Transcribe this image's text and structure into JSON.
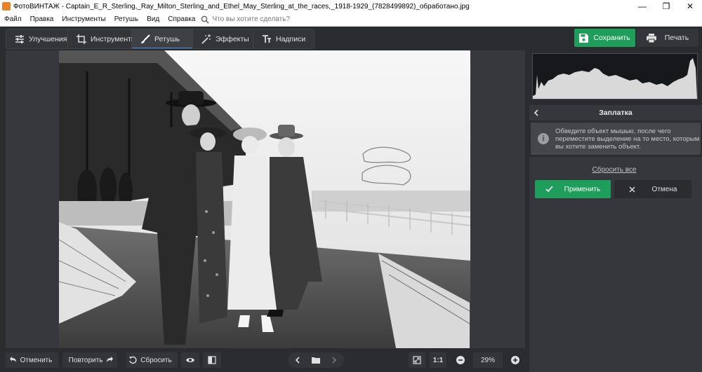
{
  "window": {
    "title": "ФотоВИНТАЖ - Captain_E_R_Sterling,_Ray_Milton_Sterling_and_Ethel_May_Sterling_at_the_races,_1918-1929_(7828499892)_обработано.jpg",
    "minimize": "—",
    "maximize": "❐",
    "close": "✕"
  },
  "menu": {
    "items": [
      "Файл",
      "Правка",
      "Инструменты",
      "Ретушь",
      "Вид",
      "Справка"
    ],
    "search_placeholder": "Что вы хотите сделать?"
  },
  "toolbar": {
    "tabs": [
      {
        "label": "Улучшения",
        "icon": "sliders-icon"
      },
      {
        "label": "Инструменты",
        "icon": "crop-icon"
      },
      {
        "label": "Ретушь",
        "icon": "brush-icon",
        "active": true
      },
      {
        "label": "Эффекты",
        "icon": "magic-wand-icon"
      },
      {
        "label": "Надписи",
        "icon": "text-icon"
      }
    ],
    "save_label": "Сохранить",
    "print_label": "Печать"
  },
  "bottom": {
    "undo_label": "Отменить",
    "redo_label": "Повторить",
    "reset_label": "Сбросить",
    "zoom_1to1": "1:1",
    "zoom_value": "29%"
  },
  "panel": {
    "title": "Заплатка",
    "info_text": "Обведите объект мышью, после чего переместите выделение на то место, которым вы хотите заменить объект.",
    "reset_all_label": "Сбросить все",
    "apply_label": "Применить",
    "cancel_label": "Отмена"
  },
  "colors": {
    "accent_green": "#1e9e5a",
    "tab_active_underline": "#4a8fd8",
    "background": "#2b2c30"
  }
}
